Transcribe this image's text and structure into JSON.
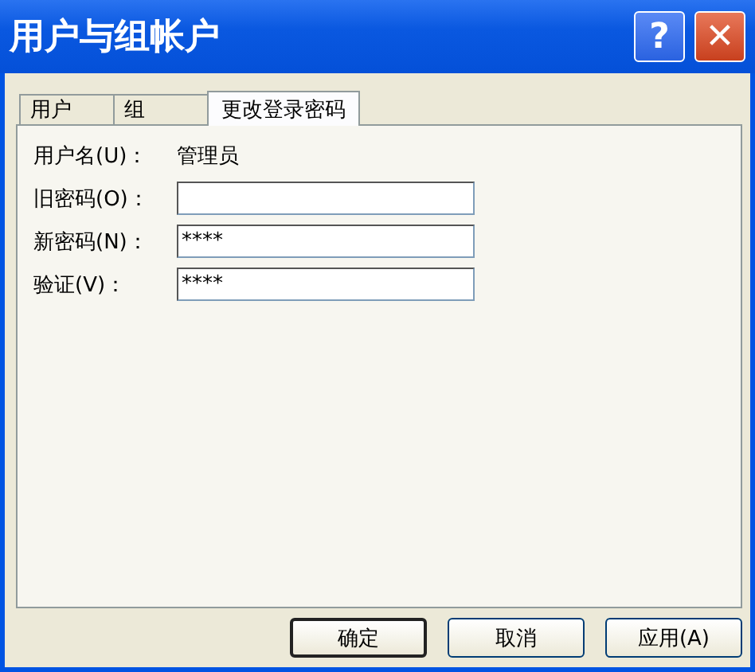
{
  "window": {
    "title": "用户与组帐户"
  },
  "title_buttons": [
    {
      "kind": "help",
      "label": "?"
    },
    {
      "kind": "close",
      "label": "✕"
    }
  ],
  "tabs": [
    {
      "label": "用户",
      "selected": false
    },
    {
      "label": "组",
      "selected": false
    },
    {
      "label": "更改登录密码",
      "selected": true
    }
  ],
  "user": {
    "label": "用户名(U)：",
    "value": "管理员"
  },
  "fields": [
    {
      "label": "旧密码(O)："
    },
    {
      "label": "新密码(N)：",
      "value": "****"
    },
    {
      "label": "验证(V)：",
      "value": "****"
    }
  ],
  "buttons": [
    {
      "label": "确定",
      "default": true
    },
    {
      "label": "取消",
      "default": false
    },
    {
      "label": "应用(A)",
      "default": false
    }
  ]
}
